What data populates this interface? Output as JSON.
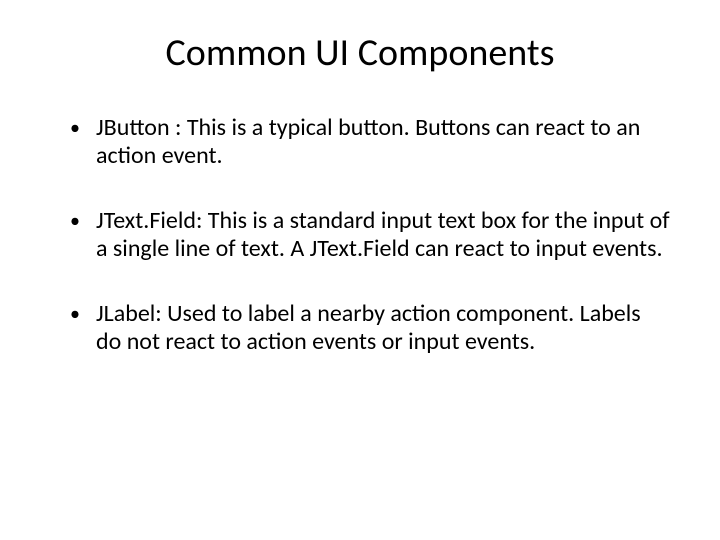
{
  "title": "Common UI Components",
  "bullets": [
    {
      "text": "JButton : This is a typical button.  Buttons can react to an action event."
    },
    {
      "text": "JText.Field: This is a standard input text box for the input of a single line of text. A JText.Field can react to input events."
    },
    {
      "text": "JLabel: Used to label a nearby action component. Labels do not react to action events or input events."
    }
  ]
}
